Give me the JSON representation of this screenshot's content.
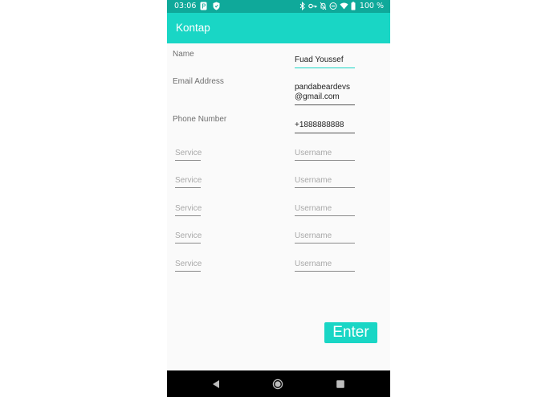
{
  "status_bar": {
    "time": "03:06",
    "left_icons": [
      "parking-icon",
      "shield-icon"
    ],
    "right_icons": [
      "bluetooth-icon",
      "key-icon",
      "bell-off-icon",
      "do-not-disturb-icon",
      "wifi-icon",
      "battery-icon"
    ],
    "battery": "100 %"
  },
  "app_bar": {
    "title": "Kontap"
  },
  "form": {
    "name_label": "Name",
    "name_value": "Fuad Youssef",
    "email_label": "Email Address",
    "email_value": "pandabeardevs@gmail.com",
    "phone_label": "Phone Number",
    "phone_value": "+1888888888",
    "social_rows": [
      {
        "service_placeholder": "Service",
        "username_placeholder": "Username"
      },
      {
        "service_placeholder": "Service",
        "username_placeholder": "Username"
      },
      {
        "service_placeholder": "Service",
        "username_placeholder": "Username"
      },
      {
        "service_placeholder": "Service",
        "username_placeholder": "Username"
      },
      {
        "service_placeholder": "Service",
        "username_placeholder": "Username"
      }
    ]
  },
  "enter_button": {
    "label": "Enter"
  },
  "nav_bar": {
    "buttons": [
      "back-icon",
      "home-icon",
      "recents-icon"
    ]
  },
  "colors": {
    "status_bar": "#0fa99a",
    "app_bar": "#19d6c5",
    "accent": "#19d6c5",
    "background": "#fafafa",
    "nav_bar": "#000000"
  }
}
